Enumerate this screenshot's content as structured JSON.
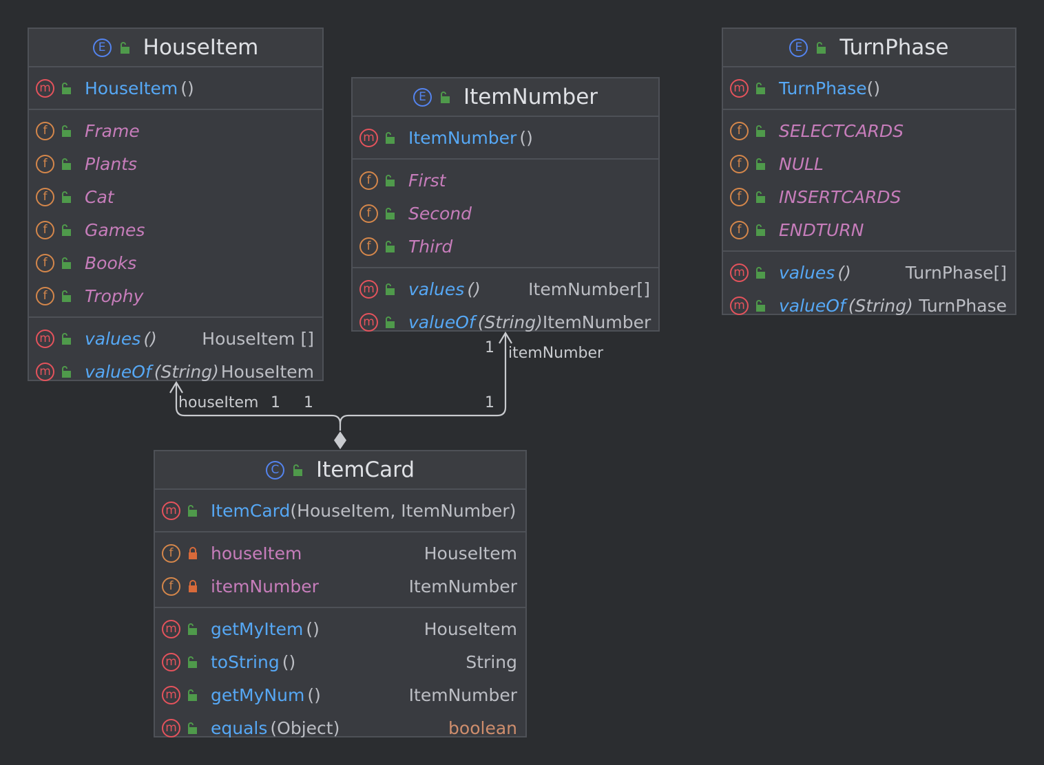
{
  "colors": {
    "background": "#2b2d30",
    "node_fill": "#393b40",
    "node_border": "#4e5157",
    "method_name": "#56a8f5",
    "field_name": "#c77dbb",
    "type_text": "#bcbec4",
    "keyword": "#cf8e6d",
    "public_icon": "#4f9a4b",
    "private_icon": "#d86a3a"
  },
  "nodes": {
    "houseitem": {
      "kind": "E",
      "title": "HouseItem",
      "constructor": {
        "name": "HouseItem",
        "params": "()"
      },
      "fields": [
        "Frame",
        "Plants",
        "Cat",
        "Games",
        "Books",
        "Trophy"
      ],
      "methods": [
        {
          "name": "values",
          "params": "()",
          "type": "HouseItem []"
        },
        {
          "name": "valueOf",
          "params": "(String)",
          "type": "HouseItem"
        }
      ]
    },
    "itemnumber": {
      "kind": "E",
      "title": "ItemNumber",
      "constructor": {
        "name": "ItemNumber",
        "params": "()"
      },
      "fields": [
        "First",
        "Second",
        "Third"
      ],
      "methods": [
        {
          "name": "values",
          "params": "()",
          "type": "ItemNumber[]"
        },
        {
          "name": "valueOf",
          "params": "(String)",
          "type": "ItemNumber"
        }
      ]
    },
    "turnphase": {
      "kind": "E",
      "title": "TurnPhase",
      "constructor": {
        "name": "TurnPhase",
        "params": "()"
      },
      "fields": [
        "SELECTCARDS",
        "NULL",
        "INSERTCARDS",
        "ENDTURN"
      ],
      "methods": [
        {
          "name": "values",
          "params": "()",
          "type": "TurnPhase[]"
        },
        {
          "name": "valueOf",
          "params": "(String)",
          "type": "TurnPhase"
        }
      ]
    },
    "itemcard": {
      "kind": "C",
      "title": "ItemCard",
      "constructor": {
        "name": "ItemCard",
        "params": "(HouseItem, ItemNumber)"
      },
      "fields": [
        {
          "name": "houseItem",
          "type": "HouseItem"
        },
        {
          "name": "itemNumber",
          "type": "ItemNumber"
        }
      ],
      "methods": [
        {
          "name": "getMyItem",
          "params": "()",
          "type": "HouseItem"
        },
        {
          "name": "toString",
          "params": "()",
          "type": "String"
        },
        {
          "name": "getMyNum",
          "params": "()",
          "type": "ItemNumber"
        },
        {
          "name": "equals",
          "params": "(Object)",
          "type": "boolean"
        }
      ]
    }
  },
  "edges": {
    "to_houseitem": {
      "role": "houseItem",
      "mult_target": "1",
      "mult_source": "1"
    },
    "to_itemnumber": {
      "role": "itemNumber",
      "mult_target": "1",
      "mult_source": "1"
    }
  },
  "badges": {
    "method": "m",
    "field": "f"
  }
}
